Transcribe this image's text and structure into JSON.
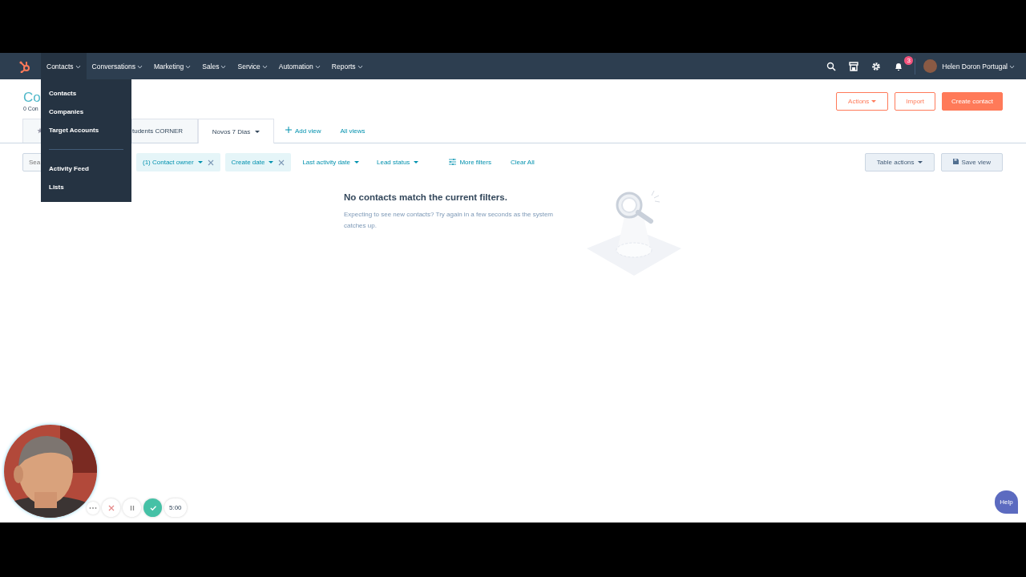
{
  "nav": {
    "items": [
      {
        "label": "Contacts",
        "selected": true
      },
      {
        "label": "Conversations",
        "selected": false
      },
      {
        "label": "Marketing",
        "selected": false
      },
      {
        "label": "Sales",
        "selected": false
      },
      {
        "label": "Service",
        "selected": false
      },
      {
        "label": "Automation",
        "selected": false
      },
      {
        "label": "Reports",
        "selected": false
      }
    ],
    "notification_count": "3",
    "account": "Helen Doron Portugal"
  },
  "menu": {
    "groups": [
      [
        "Contacts",
        "Companies",
        "Target Accounts"
      ],
      [
        "Activity Feed",
        "Lists"
      ]
    ]
  },
  "header": {
    "title": "Co",
    "subtitle": "0 Con",
    "buttons": [
      {
        "label": "Actions",
        "kind": "dropdown"
      },
      {
        "label": "Import",
        "kind": "outline"
      },
      {
        "label": "Create contact",
        "kind": "primary"
      }
    ]
  },
  "views": {
    "tabs": [
      {
        "kind": "starred",
        "selected": false
      },
      {
        "kind": "view",
        "label": "tudents CORNER",
        "selected": false
      },
      {
        "kind": "view",
        "label": "Novos 7 Dias",
        "selected": true
      }
    ],
    "links": [
      {
        "label": "Add view",
        "kind": "add"
      },
      {
        "label": "All views",
        "kind": "plain"
      }
    ]
  },
  "filters": {
    "search_placeholder": "Sea",
    "chips": [
      {
        "label": "(1) Contact owner",
        "active": true
      },
      {
        "label": "Create date",
        "active": true
      },
      {
        "label": "Last activity date",
        "active": false
      },
      {
        "label": "Lead status",
        "active": false
      }
    ],
    "more_filters": "More filters",
    "clear": "Clear All",
    "buttons": [
      {
        "label": "Table actions",
        "kind": "dropdown"
      },
      {
        "label": "Save view",
        "kind": "save"
      }
    ]
  },
  "empty_state": {
    "heading": "No contacts match the current filters.",
    "text": "Expecting to see new contacts? Try again in a few seconds as the system catches up."
  },
  "recorder": {
    "timer": "5:00"
  },
  "help": "Help"
}
